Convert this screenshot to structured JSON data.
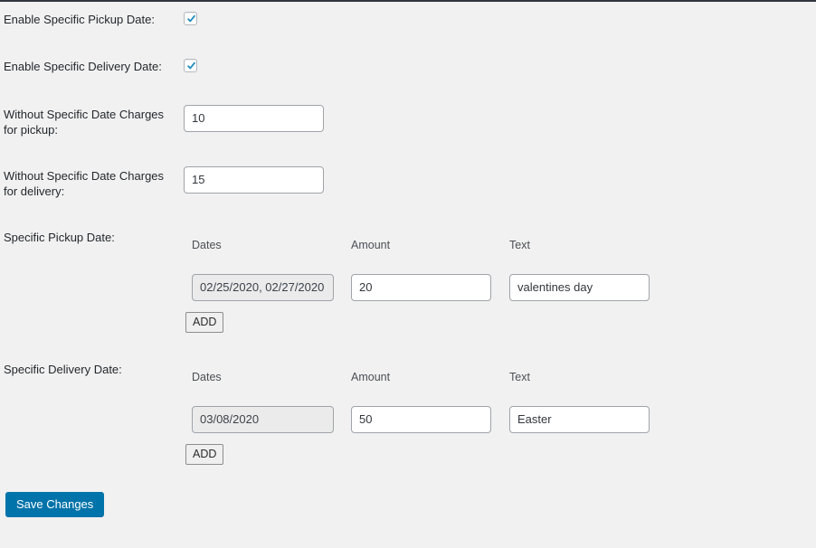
{
  "colors": {
    "background": "#f1f1f1",
    "label_text": "#23282d",
    "primary_button": "#0073aa",
    "checkbox_check": "#1e8cbe",
    "input_border": "#9fa3a8",
    "readonly_field": "#ebebeb"
  },
  "fields": {
    "enable_pickup": {
      "label": "Enable Specific Pickup Date:",
      "checked": true,
      "icon": "checkmark-icon"
    },
    "enable_delivery": {
      "label": "Enable Specific Delivery Date:",
      "checked": true,
      "icon": "checkmark-icon"
    },
    "pickup_charges": {
      "label": "Without Specific Date Charges for pickup:",
      "value": "10",
      "placeholder": ""
    },
    "delivery_charges": {
      "label": "Without Specific Date Charges for delivery:",
      "value": "15",
      "placeholder": ""
    }
  },
  "specific_pickup": {
    "label": "Specific Pickup Date:",
    "columns": [
      "Dates",
      "Amount",
      "Text"
    ],
    "rows": [
      {
        "dates": "02/25/2020, 02/27/2020",
        "amount": "20",
        "text": "valentines day"
      }
    ],
    "add_label": "ADD"
  },
  "specific_delivery": {
    "label": "Specific Delivery Date:",
    "columns": [
      "Dates",
      "Amount",
      "Text"
    ],
    "rows": [
      {
        "dates": "03/08/2020",
        "amount": "50",
        "text": "Easter"
      }
    ],
    "add_label": "ADD"
  },
  "footer": {
    "save_label": "Save Changes"
  }
}
